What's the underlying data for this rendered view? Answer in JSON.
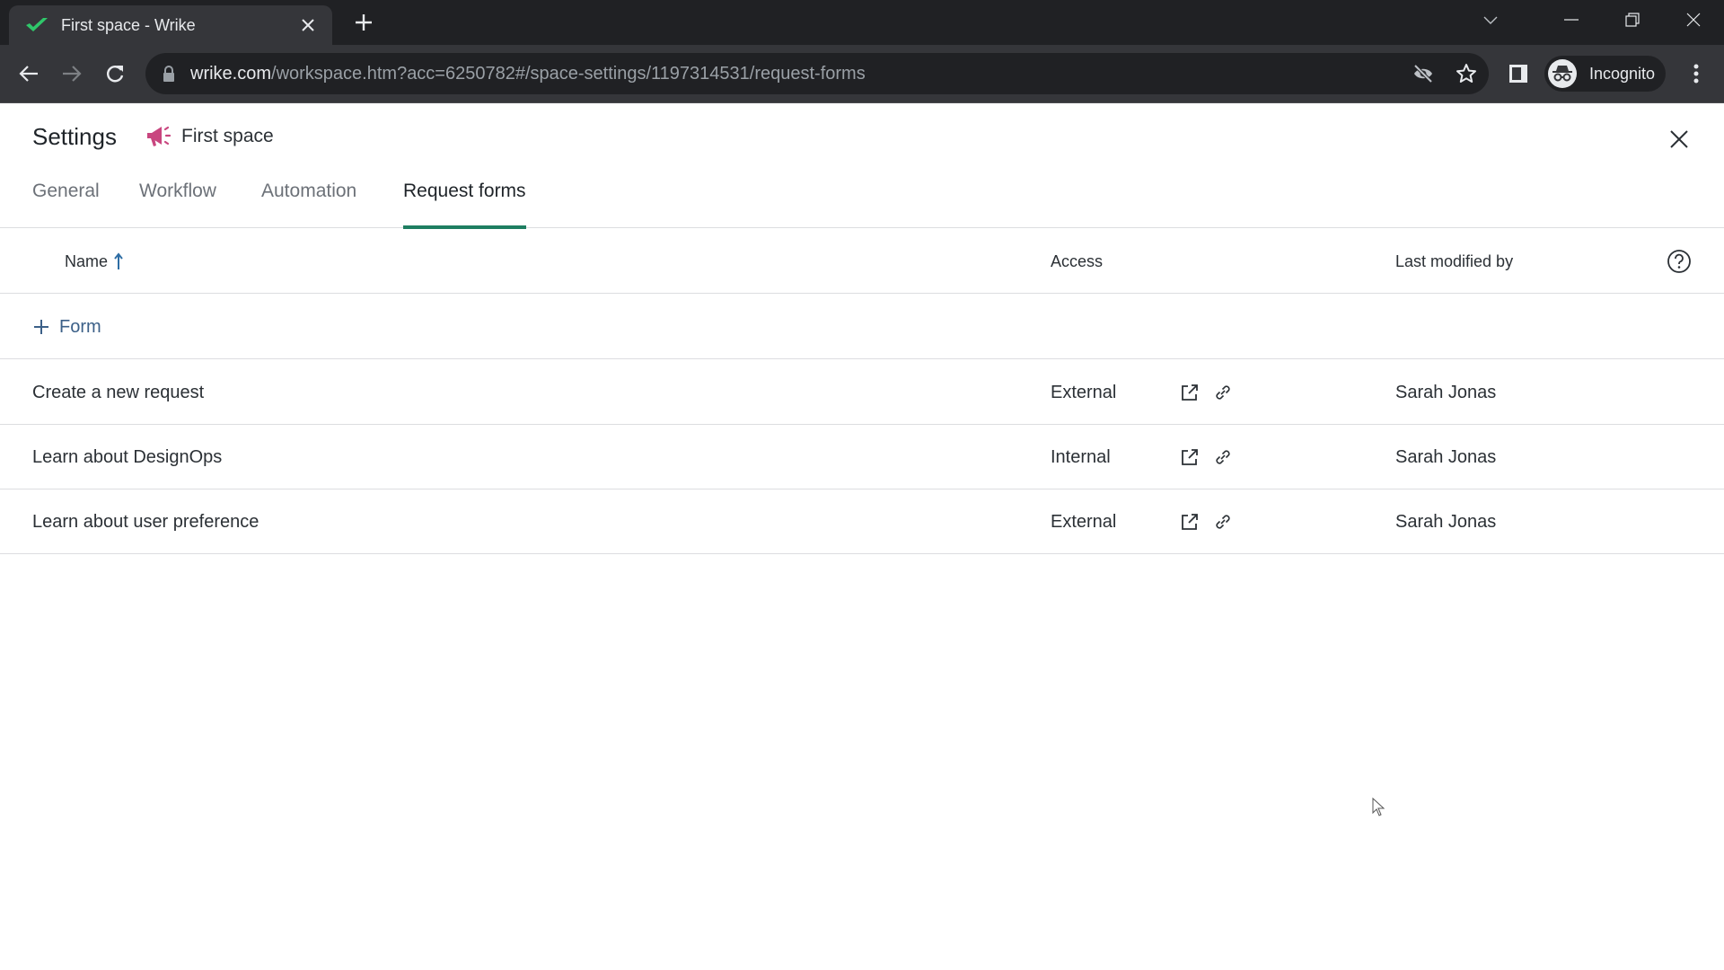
{
  "browser": {
    "tab": {
      "title": "First space - Wrike",
      "favicon": "wrike-check-icon"
    },
    "url": {
      "host": "wrike.com",
      "path": "/workspace.htm?acc=6250782#/space-settings/1197314531/request-forms"
    },
    "profile": {
      "label": "Incognito"
    },
    "window_controls": [
      "tab-search",
      "minimize",
      "restore",
      "close"
    ]
  },
  "colors": {
    "accent_green": "#1e7e61",
    "link_blue": "#3c6088",
    "space_icon": "#c9467f",
    "chrome_dark": "#202124",
    "chrome_toolbar": "#35363a"
  },
  "header": {
    "title": "Settings",
    "space": {
      "name": "First space",
      "icon": "megaphone-icon"
    }
  },
  "tabs": [
    {
      "label": "General",
      "active": false
    },
    {
      "label": "Workflow",
      "active": false
    },
    {
      "label": "Automation",
      "active": false
    },
    {
      "label": "Request forms",
      "active": true
    }
  ],
  "table": {
    "columns": {
      "name": "Name",
      "name_sort": "ascending",
      "access": "Access",
      "last_modified_by": "Last modified by"
    },
    "add_button_label": "Form",
    "rows": [
      {
        "name": "Create a new request",
        "access": "External",
        "last_modified_by": "Sarah Jonas"
      },
      {
        "name": "Learn about DesignOps",
        "access": "Internal",
        "last_modified_by": "Sarah Jonas"
      },
      {
        "name": "Learn about user preference",
        "access": "External",
        "last_modified_by": "Sarah Jonas"
      }
    ]
  }
}
